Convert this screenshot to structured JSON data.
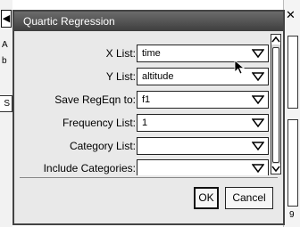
{
  "dialog": {
    "title": "Quartic Regression",
    "fields": [
      {
        "label": "X List:",
        "value": "time"
      },
      {
        "label": "Y List:",
        "value": "altitude"
      },
      {
        "label": "Save RegEqn to:",
        "value": "f1"
      },
      {
        "label": "Frequency List:",
        "value": "1"
      },
      {
        "label": "Category List:",
        "value": ""
      },
      {
        "label": "Include Categories:",
        "value": ""
      }
    ],
    "buttons": {
      "ok": "OK",
      "cancel": "Cancel"
    }
  },
  "background": {
    "left_letters": [
      "A",
      "b",
      "S"
    ],
    "right_number": "9"
  },
  "colors": {
    "titlebar": "#4a4a4a",
    "dialog_bg": "#e9e9e9"
  },
  "icons": [
    "dropdown-arrow-icon",
    "scroll-up-icon",
    "scroll-down-icon",
    "mouse-cursor-icon",
    "close-icon"
  ]
}
